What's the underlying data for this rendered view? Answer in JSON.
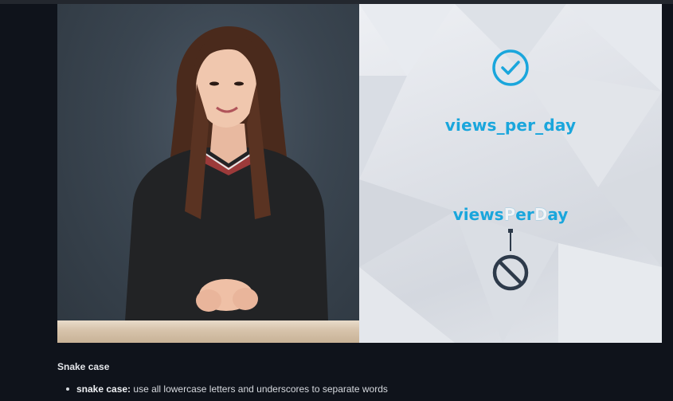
{
  "video": {
    "slide": {
      "good_example": "views_per_day",
      "bad_example_parts": [
        "views",
        "P",
        "er",
        "D",
        "ay"
      ]
    },
    "icons": {
      "good": "check-circle-icon",
      "bad": "prohibited-icon"
    },
    "colors": {
      "accent": "#1aa6dc",
      "icon_dark": "#2d3a4a"
    }
  },
  "content": {
    "section_title": "Snake case",
    "bullets": [
      {
        "term": "snake case:",
        "text": " use all lowercase letters and underscores to separate words"
      }
    ]
  }
}
